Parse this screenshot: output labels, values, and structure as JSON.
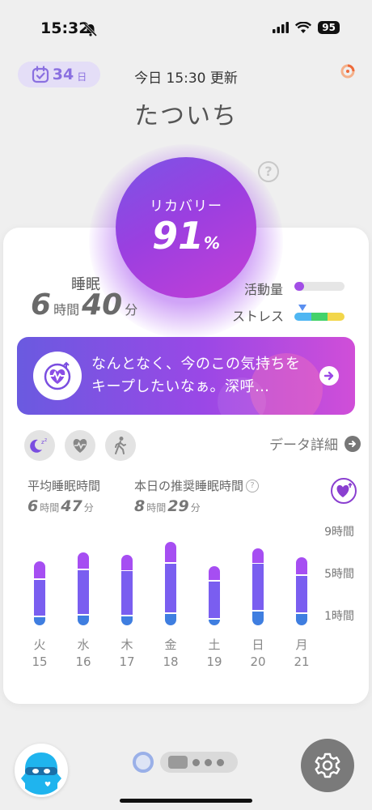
{
  "status_bar": {
    "time": "15:32",
    "battery": "95"
  },
  "header": {
    "days_count": "34",
    "days_unit": "日",
    "updated": "今日 15:30 更新",
    "user_name": "たついち"
  },
  "recovery": {
    "label": "リカバリー",
    "value": "91",
    "unit": "%"
  },
  "sleep": {
    "label": "睡眠",
    "hours": "6",
    "hours_unit": "時間",
    "minutes": "40",
    "minutes_unit": "分"
  },
  "activity": {
    "label": "活動量",
    "level": 0.2
  },
  "stress": {
    "label": "ストレス",
    "colors": [
      "#4fb6f2",
      "#44d26a",
      "#f2d64a"
    ]
  },
  "banner": {
    "message": "なんとなく、今のこの気持ちをキープしたいなぁ。深呼…"
  },
  "details": {
    "link_label": "データ詳細"
  },
  "averages": {
    "avg_label": "平均睡眠時間",
    "avg_hours": "6",
    "avg_minutes": "47",
    "rec_label": "本日の推奨睡眠時間",
    "rec_hours": "8",
    "rec_minutes": "29",
    "hours_unit": "時間",
    "minutes_unit": "分"
  },
  "chart_data": {
    "type": "bar",
    "stacked": true,
    "categories": [
      "火\n15",
      "水\n16",
      "木\n17",
      "金\n18",
      "土\n19",
      "日\n20",
      "月\n21"
    ],
    "days": [
      {
        "weekday": "火",
        "date": "15"
      },
      {
        "weekday": "水",
        "date": "16"
      },
      {
        "weekday": "木",
        "date": "17"
      },
      {
        "weekday": "金",
        "date": "18"
      },
      {
        "weekday": "土",
        "date": "19"
      },
      {
        "weekday": "日",
        "date": "20"
      },
      {
        "weekday": "月",
        "date": "21"
      }
    ],
    "series": [
      {
        "color": "#3f7ee0",
        "values": [
          0.8,
          1.0,
          0.9,
          1.1,
          0.6,
          1.4,
          1.1
        ]
      },
      {
        "color": "#7a5ef0",
        "values": [
          3.6,
          4.3,
          4.3,
          4.8,
          3.6,
          4.5,
          3.7
        ]
      },
      {
        "color": "#a64ef2",
        "values": [
          1.7,
          1.6,
          1.5,
          2.0,
          1.4,
          1.4,
          1.7
        ]
      }
    ],
    "y_ticks": [
      "9時間",
      "5時間",
      "1時間"
    ],
    "y_tick_values": [
      9,
      5,
      1
    ],
    "ylim": [
      0,
      9
    ]
  }
}
